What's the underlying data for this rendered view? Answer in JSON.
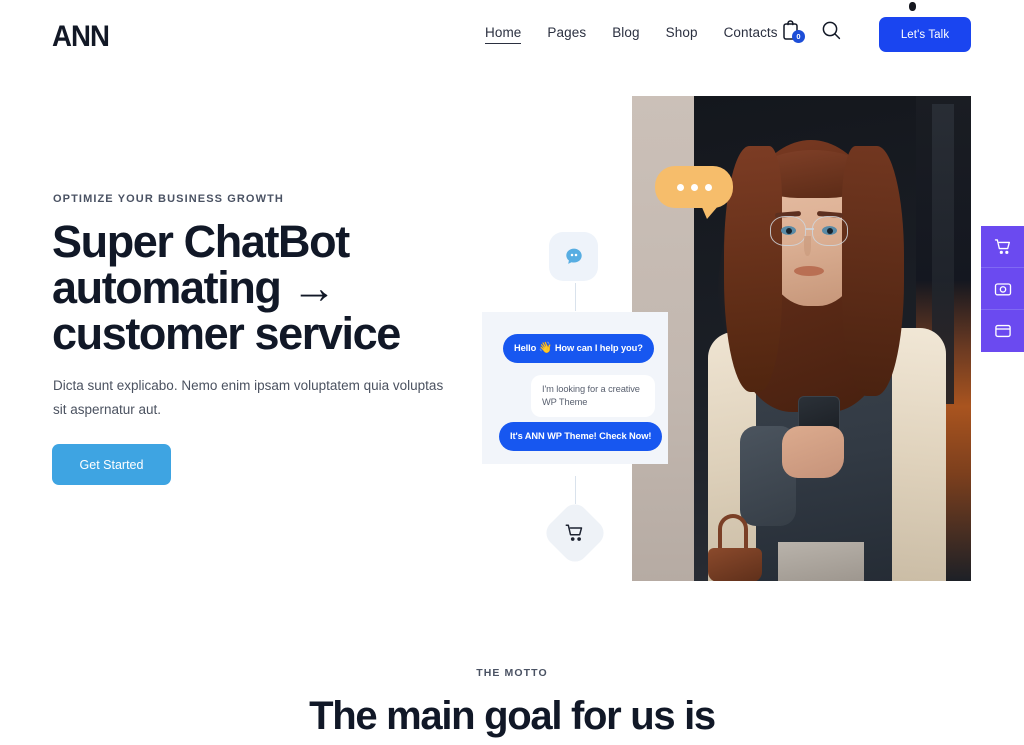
{
  "header": {
    "logo": "ANN",
    "nav": [
      {
        "label": "Home",
        "active": true
      },
      {
        "label": "Pages",
        "active": false
      },
      {
        "label": "Blog",
        "active": false
      },
      {
        "label": "Shop",
        "active": false
      },
      {
        "label": "Contacts",
        "active": false
      }
    ],
    "cart_icon": "shopping-bag-icon",
    "cart_count": "0",
    "search_icon": "search-icon",
    "cta_label": "Let's Talk",
    "cta_color": "#1A45F0"
  },
  "hero": {
    "eyebrow": "OPTIMIZE YOUR BUSINESS GROWTH",
    "title": "Super ChatBot automating → customer service",
    "subtitle": "Dicta sunt explicabo. Nemo enim ipsam voluptatem quia voluptas sit aspernatur aut.",
    "button_label": "Get Started",
    "button_color": "#3EA4E2",
    "image_alt": "Woman with glasses holding a smartphone"
  },
  "chat_flow": {
    "top_icon": "chat-bubble-icon",
    "bottom_icon": "shopping-cart-icon",
    "panel_color": "#F2F5FA",
    "messages": [
      {
        "from": "bot",
        "text": "Hello",
        "emoji": "👋",
        "text2": "How can I help you?"
      },
      {
        "from": "user",
        "text": "I'm looking for a creative WP Theme"
      },
      {
        "from": "bot",
        "text": "It's ANN WP Theme! Check Now!"
      }
    ]
  },
  "side_panel": {
    "color": "#6B4AF0",
    "buttons": [
      {
        "icon": "shopping-cart-icon",
        "name": "side-cart-button"
      },
      {
        "icon": "image-gallery-icon",
        "name": "side-gallery-button"
      },
      {
        "icon": "window-layout-icon",
        "name": "side-layout-button"
      }
    ]
  },
  "motto": {
    "eyebrow": "THE MOTTO",
    "title": "The main goal for us is"
  }
}
